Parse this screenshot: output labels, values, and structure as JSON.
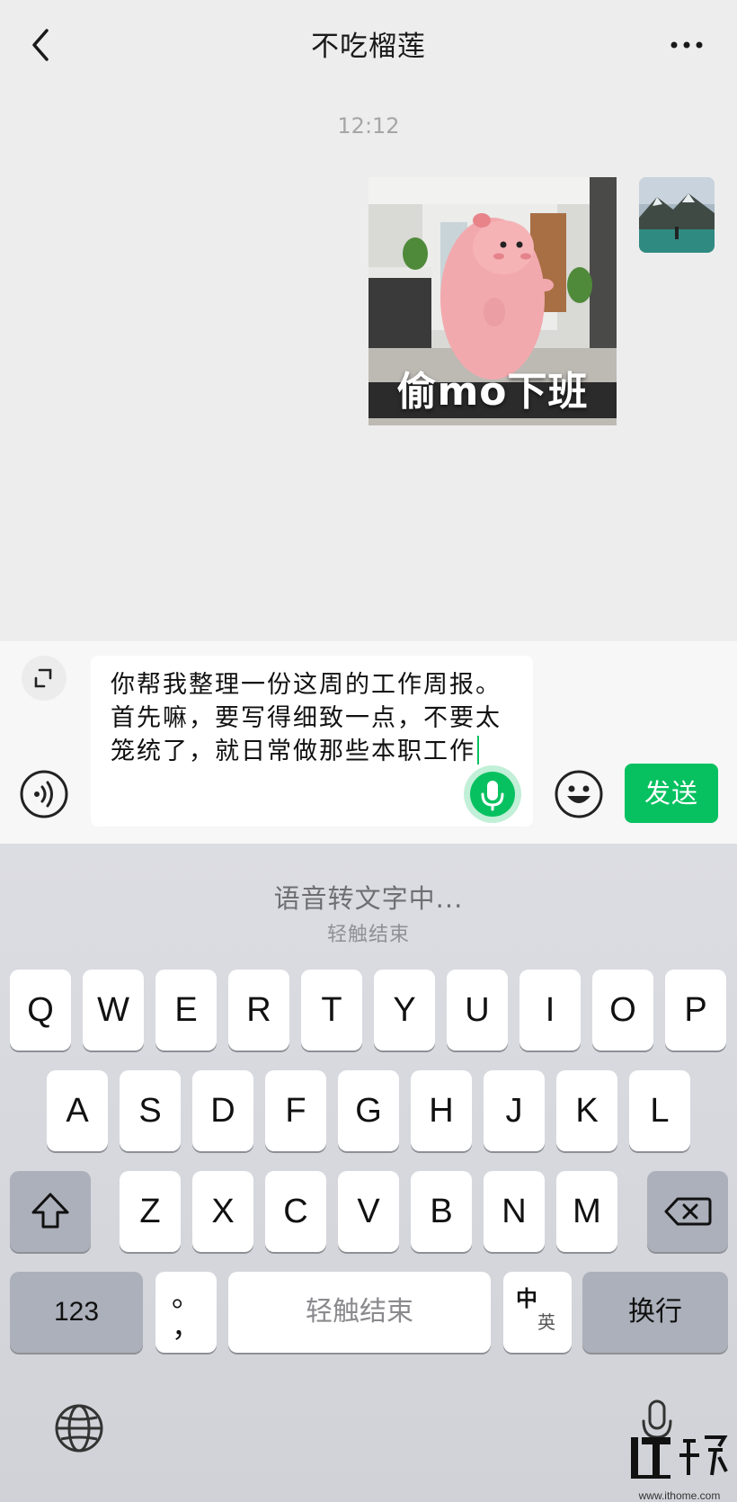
{
  "header": {
    "title": "不吃榴莲"
  },
  "chat": {
    "timestamp": "12:12",
    "sticker_caption": "偷mo下班"
  },
  "input": {
    "text": "你帮我整理一份这周的工作周报。首先嘛，要写得细致一点，不要太笼统了，就日常做那些本职工作",
    "send_label": "发送"
  },
  "keyboard": {
    "status": "语音转文字中...",
    "hint": "轻触结束",
    "row1": [
      "Q",
      "W",
      "E",
      "R",
      "T",
      "Y",
      "U",
      "I",
      "O",
      "P"
    ],
    "row2": [
      "A",
      "S",
      "D",
      "F",
      "G",
      "H",
      "J",
      "K",
      "L"
    ],
    "row3": [
      "Z",
      "X",
      "C",
      "V",
      "B",
      "N",
      "M"
    ],
    "numbers_label": "123",
    "punct_label": "。\n，",
    "space_label": "轻触结束",
    "lang_cn": "中",
    "lang_en": "英",
    "return_label": "换行"
  },
  "watermark": {
    "url": "www.ithome.com"
  },
  "colors": {
    "accent": "#07c160",
    "background": "#ededed",
    "keyboard": "#d3d5db"
  }
}
